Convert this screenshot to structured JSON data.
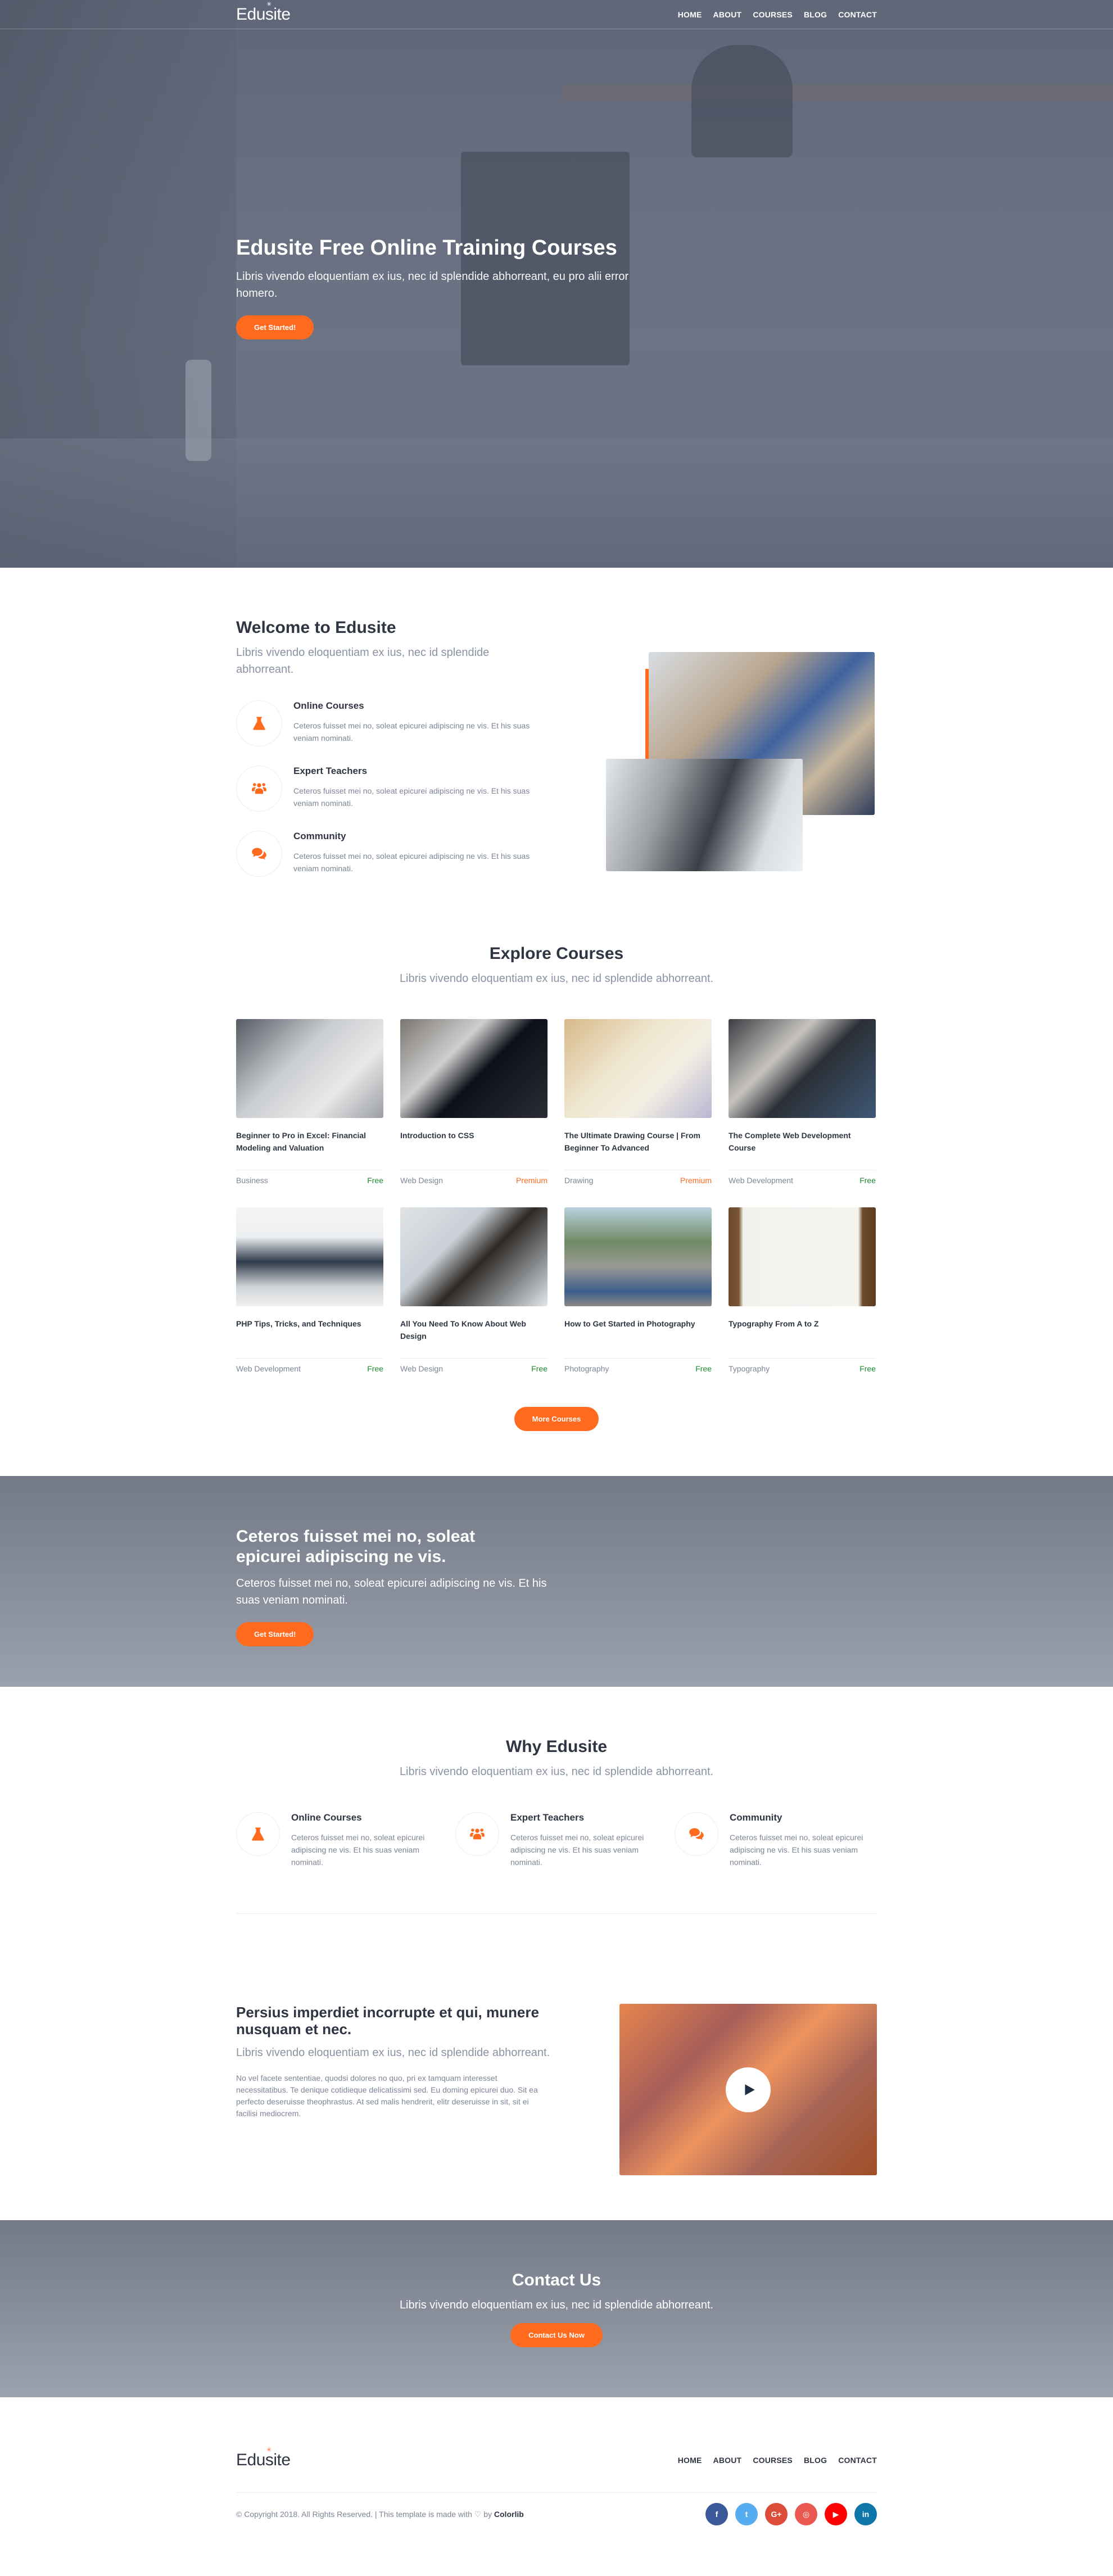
{
  "brand": {
    "name": "Edusite",
    "spark": "✳"
  },
  "nav": [
    "HOME",
    "ABOUT",
    "COURSES",
    "BLOG",
    "CONTACT"
  ],
  "hero": {
    "title": "Edusite Free Online Training Courses",
    "subtitle": "Libris vivendo eloquentiam ex ius, nec id splendide abhorreant, eu pro alii error homero.",
    "button": "Get Started!"
  },
  "welcome": {
    "title": "Welcome to Edusite",
    "lead": "Libris vivendo eloquentiam ex ius, nec id splendide abhorreant.",
    "features": [
      {
        "icon": "flask-icon",
        "title": "Online Courses",
        "text": "Ceteros fuisset mei no, soleat epicurei adipiscing ne vis. Et his suas veniam nominati."
      },
      {
        "icon": "users-icon",
        "title": "Expert Teachers",
        "text": "Ceteros fuisset mei no, soleat epicurei adipiscing ne vis. Et his suas veniam nominati."
      },
      {
        "icon": "comments-icon",
        "title": "Community",
        "text": "Ceteros fuisset mei no, soleat epicurei adipiscing ne vis. Et his suas veniam nominati."
      }
    ]
  },
  "explore": {
    "title": "Explore Courses",
    "subtitle": "Libris vivendo eloquentiam ex ius, nec id splendide abhorreant.",
    "courses": [
      {
        "title": "Beginner to Pro in Excel: Financial Modeling and Valuation",
        "category": "Business",
        "price": "Free"
      },
      {
        "title": "Introduction to CSS",
        "category": "Web Design",
        "price": "Premium"
      },
      {
        "title": "The Ultimate Drawing Course | From Beginner To Advanced",
        "category": "Drawing",
        "price": "Premium"
      },
      {
        "title": "The Complete Web Development Course",
        "category": "Web Development",
        "price": "Free"
      },
      {
        "title": "PHP Tips, Tricks, and Techniques",
        "category": "Web Development",
        "price": "Free"
      },
      {
        "title": "All You Need To Know About Web Design",
        "category": "Web Design",
        "price": "Free"
      },
      {
        "title": "How to Get Started in Photography",
        "category": "Photography",
        "price": "Free"
      },
      {
        "title": "Typography From A to Z",
        "category": "Typography",
        "price": "Free"
      }
    ],
    "more_button": "More Courses"
  },
  "cta": {
    "title": "Ceteros fuisset mei no, soleat epicurei adipiscing ne vis.",
    "text": "Ceteros fuisset mei no, soleat epicurei adipiscing ne vis. Et his suas veniam nominati.",
    "button": "Get Started!"
  },
  "why": {
    "title": "Why Edusite",
    "subtitle": "Libris vivendo eloquentiam ex ius, nec id splendide abhorreant.",
    "features": [
      {
        "icon": "flask-icon",
        "title": "Online Courses",
        "text": "Ceteros fuisset mei no, soleat epicurei adipiscing ne vis. Et his suas veniam nominati."
      },
      {
        "icon": "users-icon",
        "title": "Expert Teachers",
        "text": "Ceteros fuisset mei no, soleat epicurei adipiscing ne vis. Et his suas veniam nominati."
      },
      {
        "icon": "comments-icon",
        "title": "Community",
        "text": "Ceteros fuisset mei no, soleat epicurei adipiscing ne vis. Et his suas veniam nominati."
      }
    ]
  },
  "about": {
    "title": "Persius imperdiet incorrupte et qui, munere nusquam et nec.",
    "lead": "Libris vivendo eloquentiam ex ius, nec id splendide abhorreant.",
    "text": "No vel facete sententiae, quodsi dolores no quo, pri ex tamquam interesset necessitatibus. Te denique cotidieque delicatissimi sed. Eu doming epicurei duo. Sit ea perfecto deseruisse theophrastus. At sed malis hendrerit, elitr deseruisse in sit, sit ei facilisi mediocrem."
  },
  "contact": {
    "title": "Contact Us",
    "subtitle": "Libris vivendo eloquentiam ex ius, nec id splendide abhorreant.",
    "button": "Contact Us Now"
  },
  "footer": {
    "copyright": "© Copyright 2018. All Rights Reserved. | This template is made with ♡ by ",
    "credit": "Colorlib",
    "socials": [
      {
        "name": "facebook",
        "glyph": "f",
        "color": "#3b5998"
      },
      {
        "name": "twitter",
        "glyph": "t",
        "color": "#55acee"
      },
      {
        "name": "google-plus",
        "glyph": "G+",
        "color": "#dd4b39"
      },
      {
        "name": "instagram",
        "glyph": "◎",
        "color": "#e95950"
      },
      {
        "name": "youtube",
        "glyph": "▶",
        "color": "#ff0000"
      },
      {
        "name": "linkedin",
        "glyph": "in",
        "color": "#0e76a8"
      }
    ]
  },
  "colors": {
    "accent": "#ff6a1e",
    "heading": "#2f3542",
    "muted": "#8a92a3",
    "free": "#1e8a2e"
  }
}
